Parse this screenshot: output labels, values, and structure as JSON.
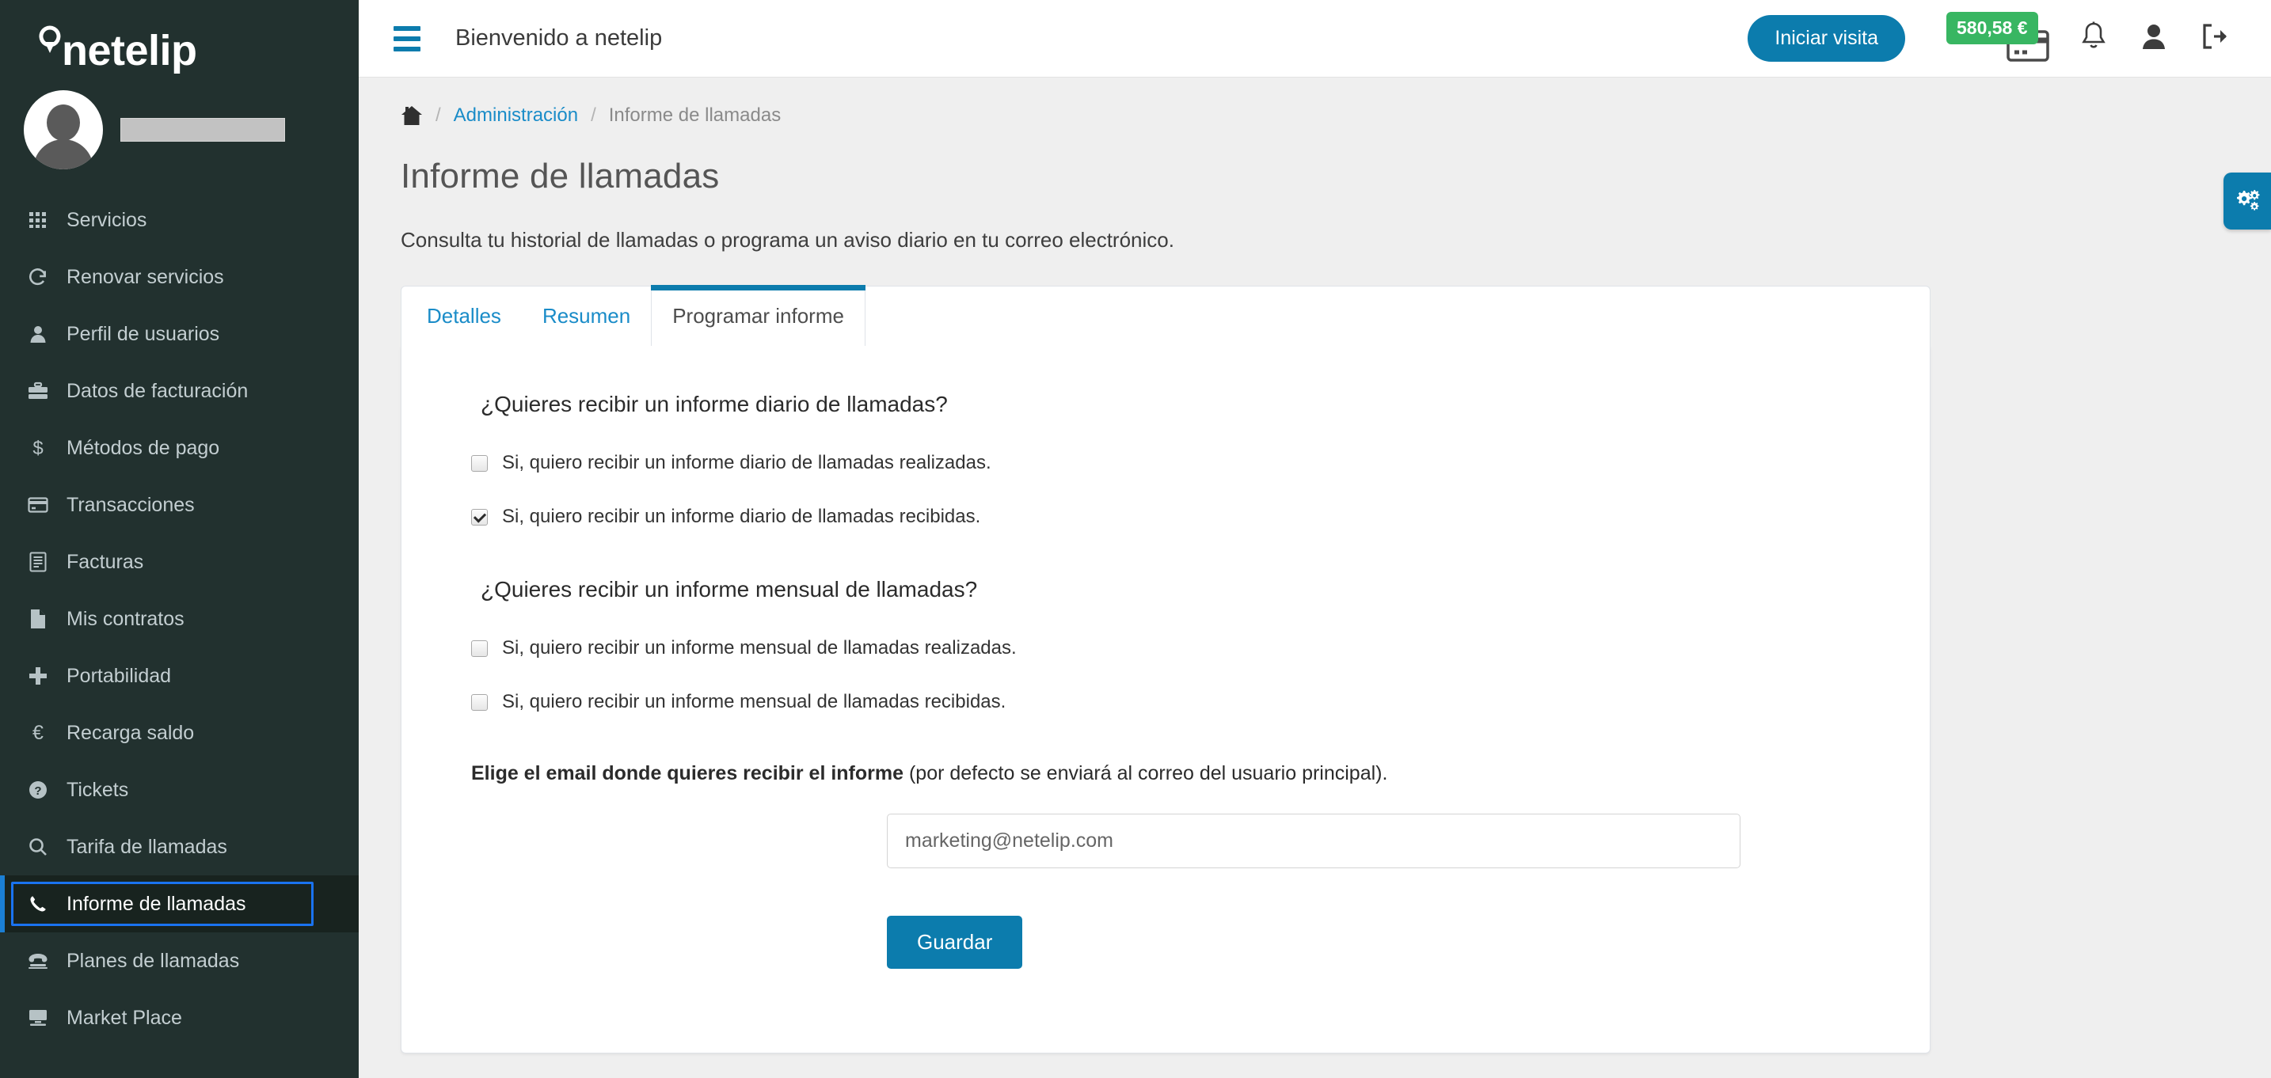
{
  "brand": {
    "name": "netelip",
    "logo_icon": "location-pin-icon"
  },
  "sidebar": {
    "avatar_icon": "user-avatar-icon",
    "user_name_masked": "",
    "items": [
      {
        "label": "Servicios",
        "icon": "grid-icon",
        "active": false
      },
      {
        "label": "Renovar servicios",
        "icon": "refresh-icon",
        "active": false
      },
      {
        "label": "Perfil de usuarios",
        "icon": "user-icon",
        "active": false
      },
      {
        "label": "Datos de facturación",
        "icon": "briefcase-icon",
        "active": false
      },
      {
        "label": "Métodos de pago",
        "icon": "dollar-icon",
        "active": false
      },
      {
        "label": "Transacciones",
        "icon": "credit-card-icon",
        "active": false
      },
      {
        "label": "Facturas",
        "icon": "invoice-list-icon",
        "active": false
      },
      {
        "label": "Mis contratos",
        "icon": "document-icon",
        "active": false
      },
      {
        "label": "Portabilidad",
        "icon": "plus-icon",
        "active": false
      },
      {
        "label": "Recarga saldo",
        "icon": "euro-icon",
        "active": false
      },
      {
        "label": "Tickets",
        "icon": "question-circle-icon",
        "active": false
      },
      {
        "label": "Tarifa de llamadas",
        "icon": "search-icon",
        "active": false
      },
      {
        "label": "Informe de llamadas",
        "icon": "phone-icon",
        "active": true
      },
      {
        "label": "Planes de llamadas",
        "icon": "telephone-icon",
        "active": false
      },
      {
        "label": "Market Place",
        "icon": "monitor-icon",
        "active": false
      }
    ]
  },
  "topbar": {
    "menu_icon": "hamburger-icon",
    "title": "Bienvenido a netelip",
    "visit_button": "Iniciar visita",
    "balance": "580,58 €",
    "card_icon": "credit-card-icon",
    "bell_icon": "bell-icon",
    "account_icon": "user-icon",
    "logout_icon": "logout-icon"
  },
  "breadcrumb": {
    "home_icon": "home-icon",
    "separator": "/",
    "parent": "Administración",
    "current": "Informe de llamadas"
  },
  "page": {
    "title": "Informe de llamadas",
    "description": "Consulta tu historial de llamadas o programa un aviso diario en tu correo electrónico."
  },
  "tabs": [
    {
      "label": "Detalles",
      "active": false
    },
    {
      "label": "Resumen",
      "active": false
    },
    {
      "label": "Programar informe",
      "active": true
    }
  ],
  "form": {
    "daily_heading": "¿Quieres recibir un informe diario de llamadas?",
    "daily_options": [
      {
        "label": "Si, quiero recibir un informe diario de llamadas realizadas.",
        "checked": false
      },
      {
        "label": "Si, quiero recibir un informe diario de llamadas recibidas.",
        "checked": true
      }
    ],
    "monthly_heading": "¿Quieres recibir un informe mensual de llamadas?",
    "monthly_options": [
      {
        "label": "Si, quiero recibir un informe mensual de llamadas realizadas.",
        "checked": false
      },
      {
        "label": "Si, quiero recibir un informe mensual de llamadas recibidas.",
        "checked": false
      }
    ],
    "email_label_bold": "Elige el email donde quieres recibir el informe",
    "email_label_rest": " (por defecto se enviará al correo del usuario principal).",
    "email_value": "marketing@netelip.com",
    "email_placeholder": "marketing@netelip.com",
    "save_button": "Guardar"
  },
  "settings_fab": {
    "icon": "gears-icon"
  },
  "colors": {
    "sidebar_bg": "#22312f",
    "accent_blue": "#0c7cad",
    "link_blue": "#1a8cc8",
    "balance_green": "#38b662",
    "active_ring": "#1a73f0"
  }
}
